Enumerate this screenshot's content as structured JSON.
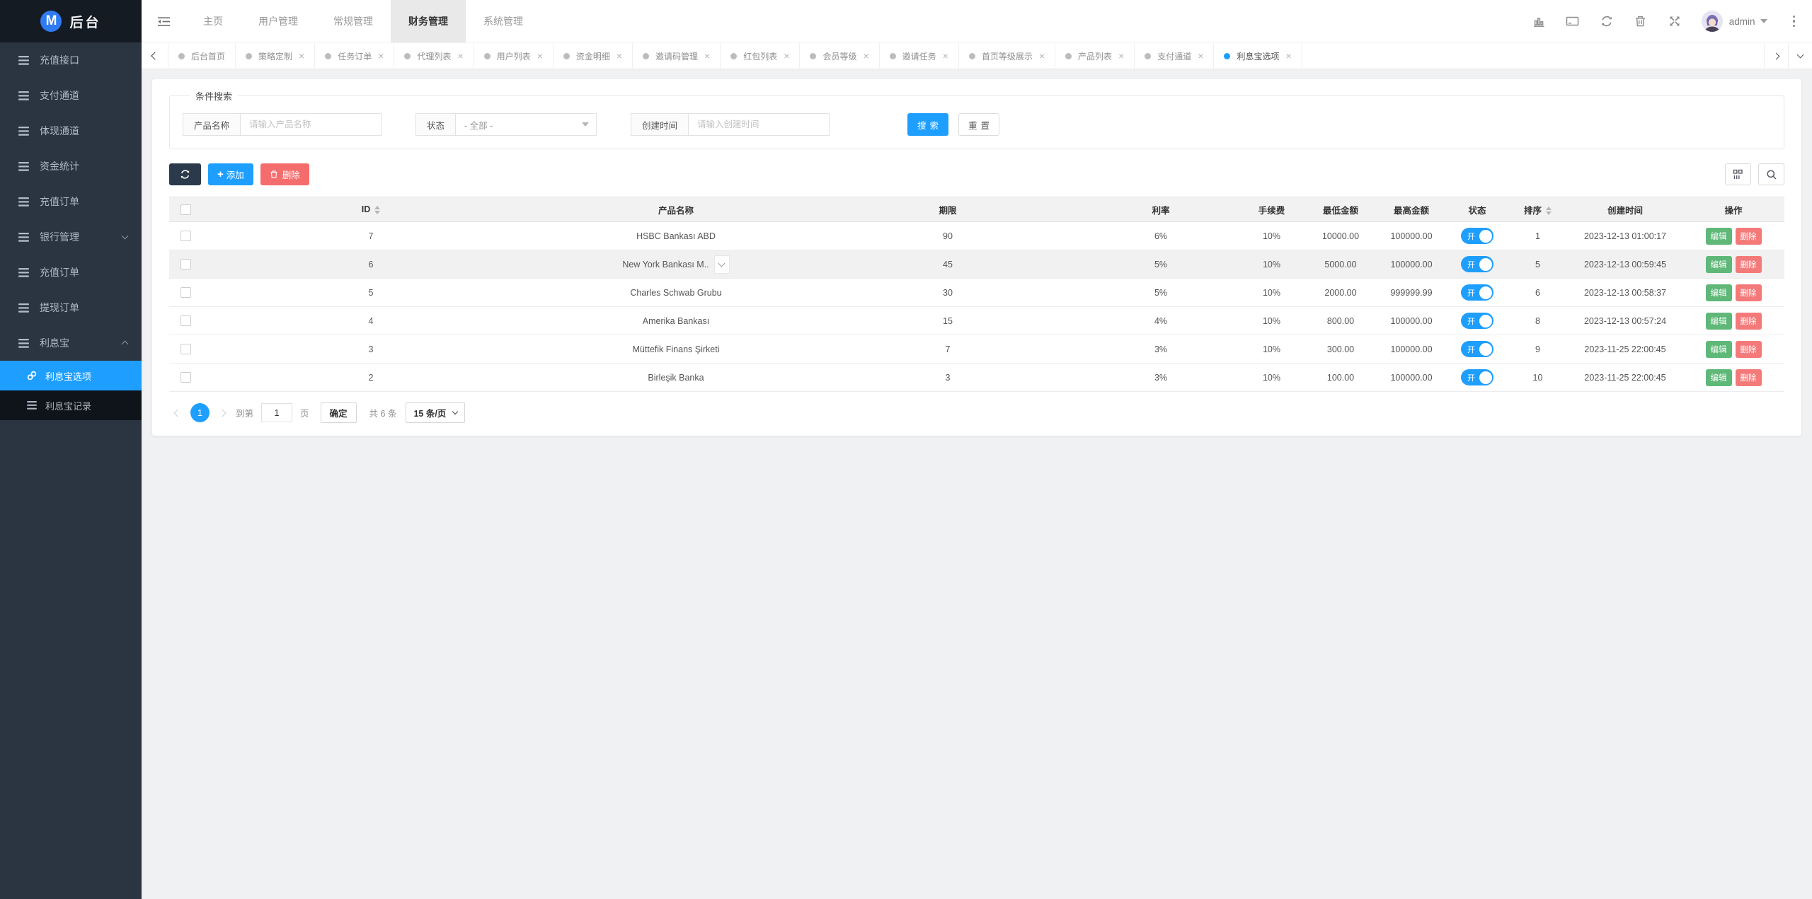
{
  "colors": {
    "accent": "#1e9fff",
    "success": "#5fb878",
    "danger": "#f56c6c",
    "sidebar_dark": "#2b3441",
    "toolbar_dark": "#2b3a4a"
  },
  "app": {
    "logo_badge": "M",
    "logo_title": "后台"
  },
  "sidebar": {
    "items": [
      {
        "label": "充值接口",
        "icon_list": true
      },
      {
        "label": "支付通道",
        "icon_list": true
      },
      {
        "label": "体现通道",
        "icon_list": true
      },
      {
        "label": "资金统计",
        "icon_list": true
      },
      {
        "label": "充值订单",
        "icon_list": true
      },
      {
        "label": "银行管理",
        "icon_list": true,
        "chev_down": true
      },
      {
        "label": "充值订单",
        "icon_list": true
      },
      {
        "label": "提现订单",
        "icon_list": true
      },
      {
        "label": "利息宝",
        "icon_list": true,
        "chev_up": true
      }
    ],
    "subitems": [
      {
        "label": "利息宝选项",
        "icon_link": true,
        "active": true
      },
      {
        "label": "利息宝记录",
        "icon_list": true
      }
    ]
  },
  "topnav": {
    "items": [
      {
        "label": "主页"
      },
      {
        "label": "用户管理"
      },
      {
        "label": "常规管理"
      },
      {
        "label": "财务管理",
        "active": true
      },
      {
        "label": "系统管理"
      }
    ]
  },
  "user": {
    "name": "admin"
  },
  "tabbar": {
    "tabs": [
      {
        "label": "后台首页"
      },
      {
        "label": "策略定制",
        "closable": true
      },
      {
        "label": "任务订单",
        "closable": true
      },
      {
        "label": "代理列表",
        "closable": true
      },
      {
        "label": "用户列表",
        "closable": true
      },
      {
        "label": "资金明细",
        "closable": true
      },
      {
        "label": "邀请码管理",
        "closable": true
      },
      {
        "label": "红包列表",
        "closable": true
      },
      {
        "label": "会员等级",
        "closable": true
      },
      {
        "label": "邀请任务",
        "closable": true
      },
      {
        "label": "首页等级展示",
        "closable": true
      },
      {
        "label": "产品列表",
        "closable": true
      },
      {
        "label": "支付通道",
        "closable": true
      },
      {
        "label": "利息宝选项",
        "closable": true,
        "active": true
      }
    ]
  },
  "search": {
    "legend": "条件搜索",
    "product_label": "产品名称",
    "product_placeholder": "请输入产品名称",
    "status_label": "状态",
    "status_value": "- 全部 -",
    "time_label": "创建时间",
    "time_placeholder": "请输入创建时间",
    "search_label": "搜索",
    "reset_label": "重置"
  },
  "toolbar": {
    "add_label": "添加",
    "delete_label": "删除"
  },
  "table": {
    "columns": {
      "id": "ID",
      "name": "产品名称",
      "term": "期限",
      "rate": "利率",
      "fee": "手续费",
      "min": "最低金额",
      "max": "最高金额",
      "status": "状态",
      "sort": "排序",
      "created": "创建时间",
      "ops": "操作"
    },
    "edit_label": "编辑",
    "delete_label": "删除",
    "rows": [
      {
        "id": "7",
        "name": "HSBC Bankası ABD",
        "term": "90",
        "rate": "6%",
        "fee": "10%",
        "min": "10000.00",
        "max": "100000.00",
        "status": "开",
        "sort": "1",
        "created": "2023-12-13 01:00:17"
      },
      {
        "id": "6",
        "name": "New York Bankası M..",
        "term": "45",
        "rate": "5%",
        "fee": "10%",
        "min": "5000.00",
        "max": "100000.00",
        "status": "开",
        "sort": "5",
        "created": "2023-12-13 00:59:45",
        "striped": true,
        "expander": true
      },
      {
        "id": "5",
        "name": "Charles Schwab Grubu",
        "term": "30",
        "rate": "5%",
        "fee": "10%",
        "min": "2000.00",
        "max": "999999.99",
        "status": "开",
        "sort": "6",
        "created": "2023-12-13 00:58:37"
      },
      {
        "id": "4",
        "name": "Amerika Bankası",
        "term": "15",
        "rate": "4%",
        "fee": "10%",
        "min": "800.00",
        "max": "100000.00",
        "status": "开",
        "sort": "8",
        "created": "2023-12-13 00:57:24"
      },
      {
        "id": "3",
        "name": "Müttefik Finans Şirketi",
        "term": "7",
        "rate": "3%",
        "fee": "10%",
        "min": "300.00",
        "max": "100000.00",
        "status": "开",
        "sort": "9",
        "created": "2023-11-25 22:00:45"
      },
      {
        "id": "2",
        "name": "Birleşik Banka",
        "term": "3",
        "rate": "3%",
        "fee": "10%",
        "min": "100.00",
        "max": "100000.00",
        "status": "开",
        "sort": "10",
        "created": "2023-11-25 22:00:45"
      }
    ]
  },
  "pagination": {
    "page": "1",
    "goto_prefix": "到第",
    "goto_value": "1",
    "goto_suffix": "页",
    "confirm": "确定",
    "total": "共 6 条",
    "page_size": "15 条/页"
  },
  "icons": {
    "close": "×",
    "plus": "+"
  }
}
